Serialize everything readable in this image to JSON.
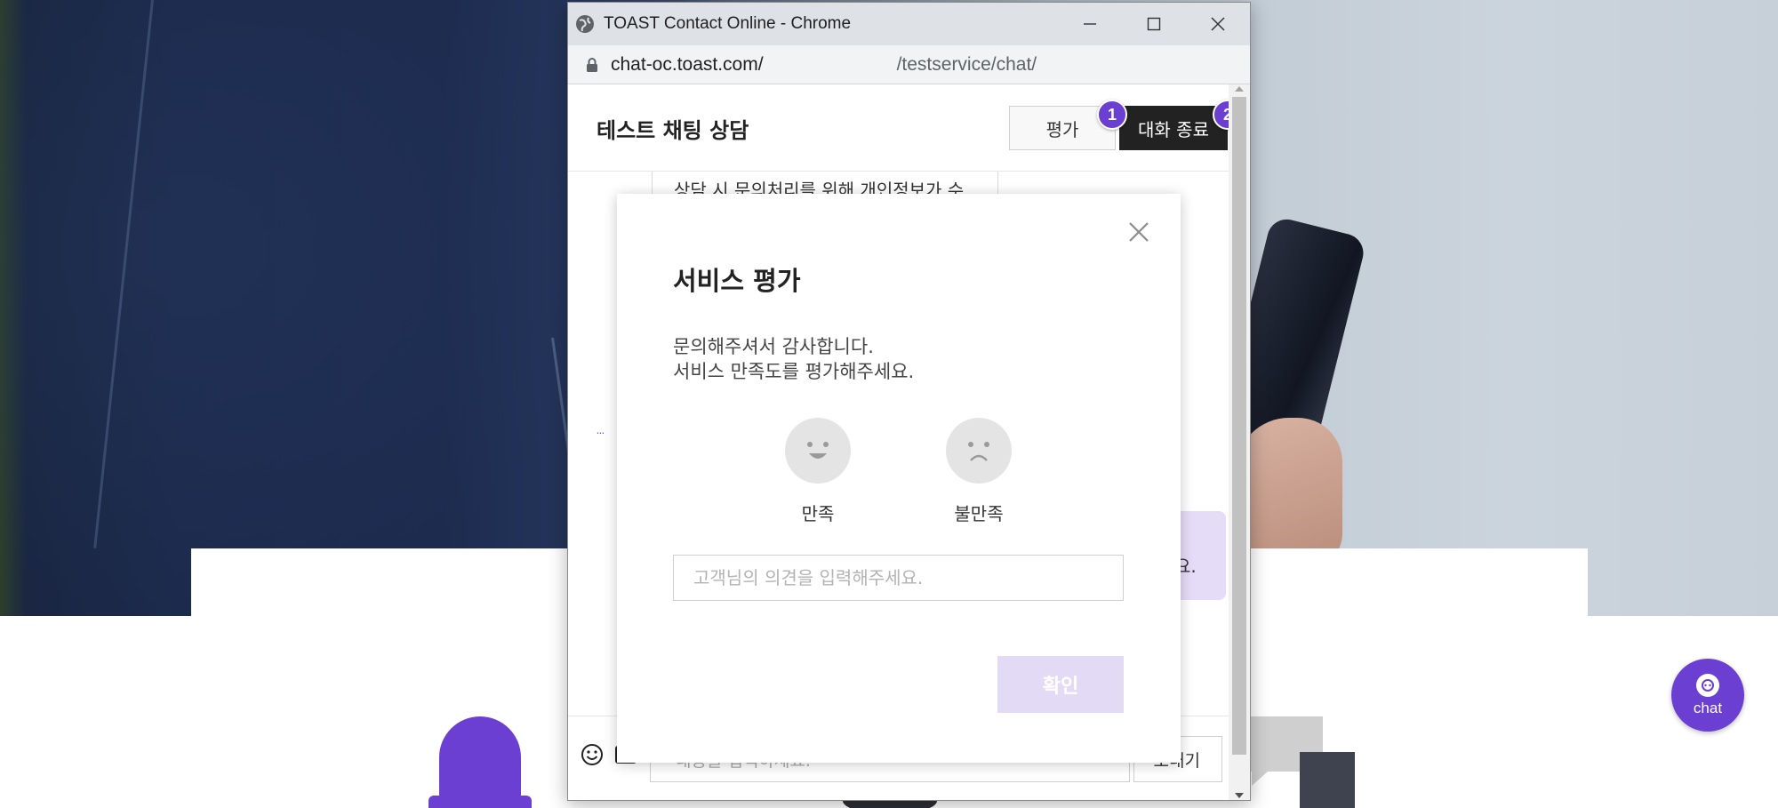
{
  "window": {
    "title": "TOAST Contact Online - Chrome",
    "url_host": "chat-oc.toast.com/",
    "url_path": "/testservice/chat/"
  },
  "chat": {
    "title": "테스트 채팅 상담",
    "rate_button": "평가",
    "end_button": "대화 종료",
    "notice_text": "상담 시 문의처리를 위해 개인정보가 수",
    "agent_bubble_text": "요.",
    "input_placeholder": "내용을 입력하세요.",
    "send_button": "보내기"
  },
  "markers": [
    "1",
    "2"
  ],
  "modal": {
    "title": "서비스 평가",
    "desc_line1": "문의해주셔서 감사합니다.",
    "desc_line2": "서비스 만족도를 평가해주세요.",
    "satisfied_label": "만족",
    "dissatisfied_label": "불만족",
    "opinion_placeholder": "고객님의 의견을 입력해주세요.",
    "confirm_button": "확인"
  },
  "fab": {
    "label": "chat"
  },
  "colors": {
    "accent": "#6a3fd2",
    "dark_button": "#222222",
    "confirm_disabled": "#e3dbf6",
    "agent_bubble": "#e5dcf7"
  },
  "icons": [
    "globe-icon",
    "minimize-icon",
    "maximize-icon",
    "close-icon",
    "lock-icon",
    "emoji-icon",
    "attach-icon",
    "smile-face-icon",
    "sad-face-icon",
    "chat-headset-icon"
  ]
}
